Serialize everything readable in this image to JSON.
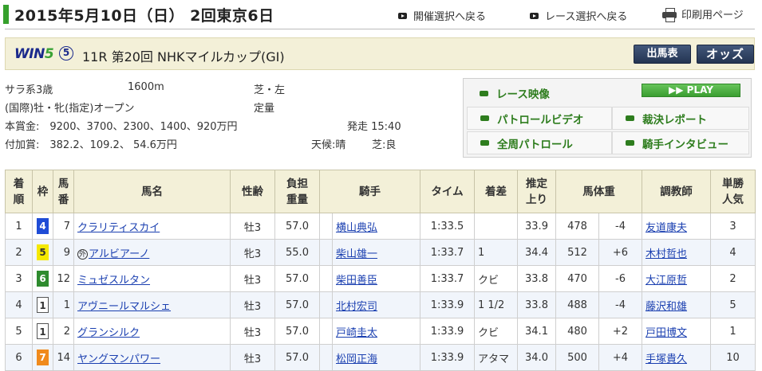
{
  "header": {
    "date_title": "2015年5月10日（日） 2回東京6日",
    "back_meeting": "開催選択へ戻る",
    "back_race": "レース選択へ戻る",
    "print_page": "印刷用ページ"
  },
  "race": {
    "win5_logo": "WIN5",
    "win5_number": "⑤",
    "title": "11R 第20回 NHKマイルカップ(GI)",
    "btn_entries": "出馬表",
    "btn_odds": "オッズ"
  },
  "info": {
    "class": "サラ系3歳",
    "distance": "1600m",
    "surface": "芝・左",
    "conditions": "(国際)牡・牝(指定)オープン",
    "weight_rule": "定量",
    "prize_main": "本賞金:　9200、3700、2300、1400、920万円",
    "start_time": "発走 15:40",
    "prize_extra": "付加賞:　382.2、109.2、 54.6万円",
    "weather": "天候:晴",
    "track": "芝:良"
  },
  "video": {
    "race_video": "レース映像",
    "play": "PLAY",
    "patrol_video": "パトロールビデオ",
    "judge_report": "裁決レポート",
    "full_patrol": "全周パトロール",
    "jockey_interview": "騎手インタビュー"
  },
  "table": {
    "headers": {
      "rank": "着\n順",
      "waku": "枠",
      "num": "馬\n番",
      "horse": "馬名",
      "sexage": "性齢",
      "weight": "負担\n重量",
      "jockey": "騎手",
      "time": "タイム",
      "margin": "着差",
      "last3f": "推定\n上り",
      "bodyweight": "馬体重",
      "trainer": "調教師",
      "pop": "単勝\n人気"
    },
    "rows": [
      {
        "rank": "1",
        "waku": "4",
        "num": "7",
        "foreign": "",
        "horse": "クラリティスカイ",
        "sexage": "牡3",
        "weight": "57.0",
        "jockey": "横山典弘",
        "time": "1:33.5",
        "margin": "",
        "last3f": "33.9",
        "bw": "478",
        "bwdiff": "-4",
        "trainer": "友道康夫",
        "pop": "3"
      },
      {
        "rank": "2",
        "waku": "5",
        "num": "9",
        "foreign": "外",
        "horse": "アルビアーノ",
        "sexage": "牝3",
        "weight": "55.0",
        "jockey": "柴山雄一",
        "time": "1:33.7",
        "margin": "1",
        "last3f": "34.4",
        "bw": "512",
        "bwdiff": "+6",
        "trainer": "木村哲也",
        "pop": "4"
      },
      {
        "rank": "3",
        "waku": "6",
        "num": "12",
        "foreign": "",
        "horse": "ミュゼスルタン",
        "sexage": "牡3",
        "weight": "57.0",
        "jockey": "柴田善臣",
        "time": "1:33.7",
        "margin": "クビ",
        "last3f": "33.8",
        "bw": "470",
        "bwdiff": "-6",
        "trainer": "大江原哲",
        "pop": "2"
      },
      {
        "rank": "4",
        "waku": "1",
        "num": "1",
        "foreign": "",
        "horse": "アヴニールマルシェ",
        "sexage": "牡3",
        "weight": "57.0",
        "jockey": "北村宏司",
        "time": "1:33.9",
        "margin": "1 1/2",
        "last3f": "33.8",
        "bw": "488",
        "bwdiff": "-4",
        "trainer": "藤沢和雄",
        "pop": "5"
      },
      {
        "rank": "5",
        "waku": "1",
        "num": "2",
        "foreign": "",
        "horse": "グランシルク",
        "sexage": "牡3",
        "weight": "57.0",
        "jockey": "戸崎圭太",
        "time": "1:33.9",
        "margin": "クビ",
        "last3f": "34.1",
        "bw": "480",
        "bwdiff": "+2",
        "trainer": "戸田博文",
        "pop": "1"
      },
      {
        "rank": "6",
        "waku": "7",
        "num": "14",
        "foreign": "",
        "horse": "ヤングマンパワー",
        "sexage": "牡3",
        "weight": "57.0",
        "jockey": "松岡正海",
        "time": "1:33.9",
        "margin": "アタマ",
        "last3f": "34.0",
        "bw": "500",
        "bwdiff": "+4",
        "trainer": "手塚貴久",
        "pop": "10"
      }
    ]
  },
  "colors": {
    "waku_1": "#ffffff",
    "waku_4": "#1f4cd6",
    "waku_5": "#f5e800",
    "waku_6": "#2e8b2e",
    "waku_7": "#f08a1c",
    "header_bg": "#f3f0d8",
    "link": "#1a3fb0",
    "accent_green": "#36a02c"
  }
}
